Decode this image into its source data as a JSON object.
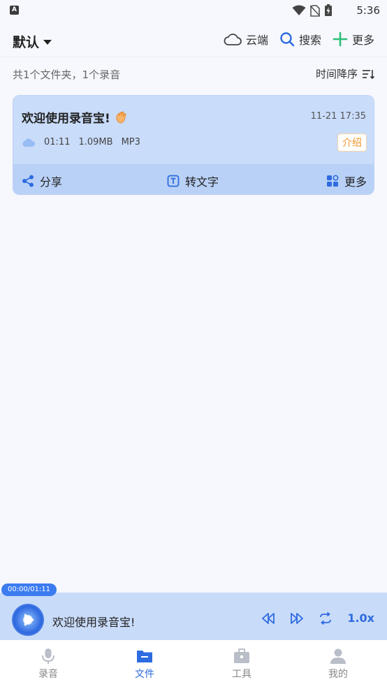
{
  "status_bar": {
    "time": "5:36",
    "left_badge": "A"
  },
  "top_bar": {
    "folder": "默认",
    "cloud_label": "云端",
    "search_label": "搜索",
    "more_label": "更多"
  },
  "summary": {
    "text": "共1个文件夹，1个录音",
    "sort_label": "时间降序"
  },
  "recording": {
    "title": "欢迎使用录音宝!",
    "datetime": "11-21 17:35",
    "duration": "01:11",
    "size": "1.09MB",
    "format": "MP3",
    "badge": "介绍",
    "actions": {
      "share": "分享",
      "transcribe": "转文字",
      "more": "更多"
    }
  },
  "player": {
    "time": "00:00/01:11",
    "title": "欢迎使用录音宝!",
    "speed": "1.0x"
  },
  "bottom_nav": {
    "items": [
      {
        "label": "录音"
      },
      {
        "label": "文件"
      },
      {
        "label": "工具"
      },
      {
        "label": "我的"
      }
    ]
  },
  "colors": {
    "accent": "#2d6be0",
    "card_bg": "#c9dcfa",
    "card_action_bg": "#b9d1f7",
    "badge_orange": "#f0962c",
    "add_green": "#2dbf7a"
  }
}
